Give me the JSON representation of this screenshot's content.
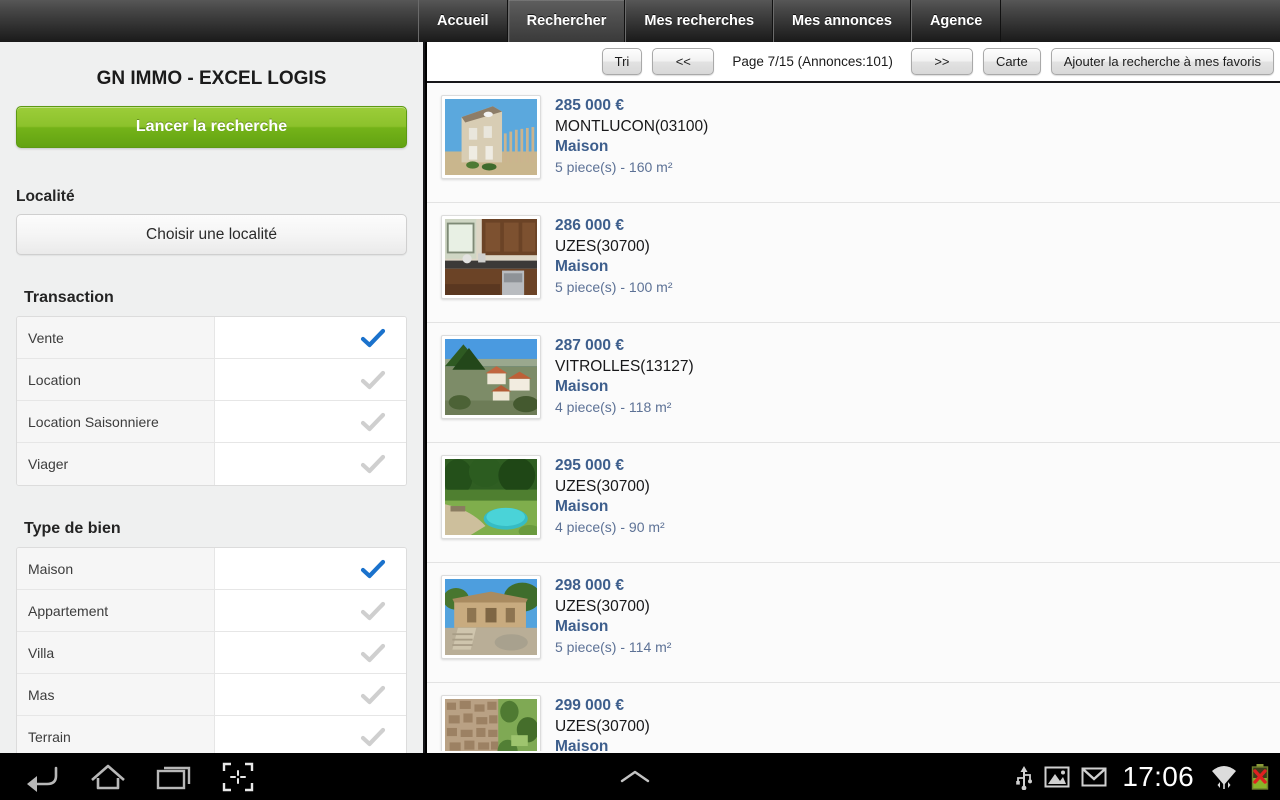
{
  "navbar": {
    "tabs": [
      {
        "label": "Accueil",
        "active": false
      },
      {
        "label": "Rechercher",
        "active": true
      },
      {
        "label": "Mes recherches",
        "active": false
      },
      {
        "label": "Mes annonces",
        "active": false
      },
      {
        "label": "Agence",
        "active": false
      }
    ]
  },
  "sidebar": {
    "app_title": "GN IMMO - EXCEL LOGIS",
    "search_button": "Lancer la recherche",
    "locality_label": "Localité",
    "locality_button": "Choisir une localité",
    "transaction": {
      "title": "Transaction",
      "options": [
        {
          "label": "Vente",
          "checked": true
        },
        {
          "label": "Location",
          "checked": false
        },
        {
          "label": "Location Saisonniere",
          "checked": false
        },
        {
          "label": "Viager",
          "checked": false
        }
      ]
    },
    "property_type": {
      "title": "Type de bien",
      "options": [
        {
          "label": "Maison",
          "checked": true
        },
        {
          "label": "Appartement",
          "checked": false
        },
        {
          "label": "Villa",
          "checked": false
        },
        {
          "label": "Mas",
          "checked": false
        },
        {
          "label": "Terrain",
          "checked": false
        }
      ]
    }
  },
  "toolbar": {
    "sort_label": "Tri",
    "prev_label": "<<",
    "page_info": "Page 7/15 (Annonces:101)",
    "next_label": ">>",
    "map_label": "Carte",
    "favorite_label": "Ajouter la recherche à mes favoris"
  },
  "listings": [
    {
      "price": "285 000 €",
      "city": "MONTLUCON(03100)",
      "type": "Maison",
      "details": "5 piece(s) - 160 m²",
      "thumb": "stone-house"
    },
    {
      "price": "286 000 €",
      "city": "UZES(30700)",
      "type": "Maison",
      "details": "5 piece(s) - 100 m²",
      "thumb": "kitchen"
    },
    {
      "price": "287 000 €",
      "city": "VITROLLES(13127)",
      "type": "Maison",
      "details": "4 piece(s) - 118 m²",
      "thumb": "hillside-village"
    },
    {
      "price": "295 000 €",
      "city": "UZES(30700)",
      "type": "Maison",
      "details": "4 piece(s) - 90 m²",
      "thumb": "garden-pool"
    },
    {
      "price": "298 000 €",
      "city": "UZES(30700)",
      "type": "Maison",
      "details": "5 piece(s) - 114 m²",
      "thumb": "stone-villa"
    },
    {
      "price": "299 000 €",
      "city": "UZES(30700)",
      "type": "Maison",
      "details": "",
      "thumb": "aerial-town"
    }
  ],
  "system_bar": {
    "clock": "17:06",
    "left_icons": [
      "back-icon",
      "home-icon",
      "recent-apps-icon",
      "screenshot-icon"
    ],
    "center_icon": "chevron-up-icon",
    "right_icons": [
      "usb-icon",
      "screenshot-notification-icon",
      "mail-icon",
      "wifi-icon",
      "battery-error-icon"
    ]
  },
  "colors": {
    "accent_green": "#8cc22c",
    "link_blue": "#3d5e8c",
    "check_blue": "#1b72cc",
    "check_gray": "#cfcfcf"
  }
}
